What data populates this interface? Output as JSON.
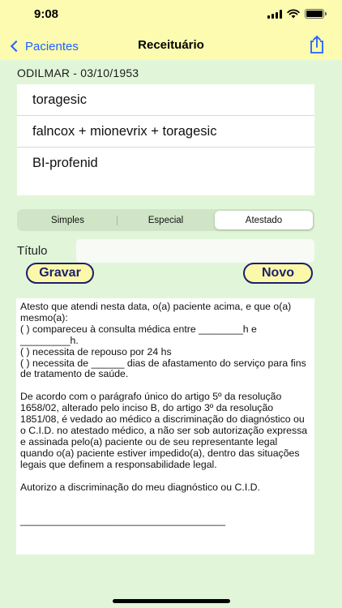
{
  "status_bar": {
    "time": "9:08"
  },
  "nav": {
    "back_label": "Pacientes",
    "title": "Receituário",
    "share_icon": "share-icon"
  },
  "patient": {
    "header": "ODILMAR - 03/10/1953"
  },
  "medications": [
    "toragesic",
    "falncox + mionevrix + toragesic",
    "BI-profenid"
  ],
  "segments": {
    "items": [
      "Simples",
      "Especial",
      "Atestado"
    ],
    "selected": "Atestado"
  },
  "form": {
    "title_label": "Título",
    "title_value": "",
    "title_placeholder": ""
  },
  "buttons": {
    "save_label": "Gravar",
    "new_label": "Novo"
  },
  "attestation_text": "Atesto que atendi nesta data, o(a) paciente acima, e que o(a) mesmo(a):\n( ) compareceu à consulta médica entre ________h e _________h.\n( ) necessita de repouso por 24 hs\n( ) necessita de ______ dias de afastamento do serviço para fins de tratamento de saúde.\n\nDe acordo com o parágrafo único do artigo 5º da resolução 1658/02, alterado pelo inciso B, do artigo 3º da resolução 1851/08, é vedado ao médico a discriminação do diagnóstico ou o C.I.D. no atestado médico, a não ser sob autorização expressa e assinada pelo(a) paciente ou de seu representante legal quando o(a) paciente estiver impedido(a), dentro das situações legais que definem a responsabilidade legal.\n\nAutorizo a discriminação do meu diagnóstico ou C.I.D.\n\n\n_____________________________________",
  "colors": {
    "nav_background": "#fdfbb0",
    "page_background": "#e1f6d9",
    "accent_blue": "#1f62ff",
    "button_border": "#1b1f6e"
  }
}
